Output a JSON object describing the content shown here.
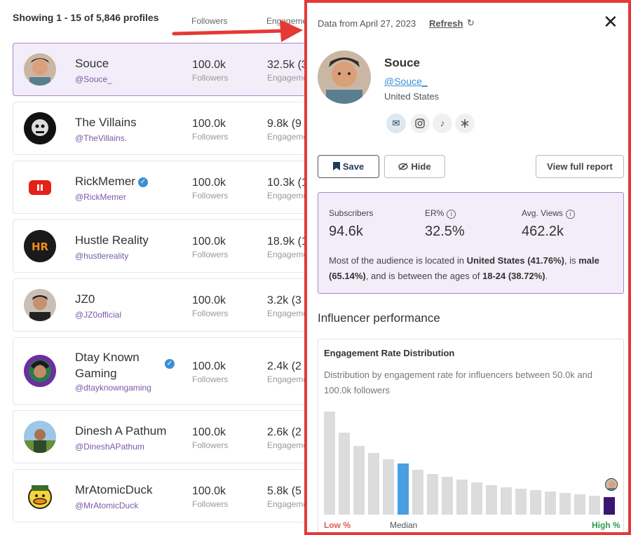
{
  "list": {
    "showing": "Showing 1 - 15 of 5,846 profiles",
    "col_followers": "Followers",
    "col_engagement": "Engagement",
    "profiles": [
      {
        "name": "Souce",
        "handle": "@Souce_",
        "followers": "100.0k",
        "followers_label": "Followers",
        "engagement": "32.5k (3",
        "engagement_label": "Engagement",
        "verified": false
      },
      {
        "name": "The Villains",
        "handle": "@TheVillains.",
        "followers": "100.0k",
        "followers_label": "Followers",
        "engagement": "9.8k (9",
        "engagement_label": "Engagement",
        "verified": false
      },
      {
        "name": "RickMemer",
        "handle": "@RickMemer",
        "followers": "100.0k",
        "followers_label": "Followers",
        "engagement": "10.3k (1",
        "engagement_label": "Engagement",
        "verified": true
      },
      {
        "name": "Hustle Reality",
        "handle": "@hustlereality",
        "followers": "100.0k",
        "followers_label": "Followers",
        "engagement": "18.9k (1",
        "engagement_label": "Engagement",
        "verified": false
      },
      {
        "name": "JZ0",
        "handle": "@JZ0official",
        "followers": "100.0k",
        "followers_label": "Followers",
        "engagement": "3.2k (3",
        "engagement_label": "Engagement",
        "verified": false
      },
      {
        "name": "Dtay Known Gaming",
        "handle": "@dtayknowngaming",
        "followers": "100.0k",
        "followers_label": "Followers",
        "engagement": "2.4k (2",
        "engagement_label": "Engagement",
        "verified": true
      },
      {
        "name": "Dinesh A Pathum",
        "handle": "@DineshAPathum",
        "followers": "100.0k",
        "followers_label": "Followers",
        "engagement": "2.6k (2",
        "engagement_label": "Engagement",
        "verified": false
      },
      {
        "name": "MrAtomicDuck",
        "handle": "@MrAtomicDuck",
        "followers": "100.0k",
        "followers_label": "Followers",
        "engagement": "5.8k (5",
        "engagement_label": "Engagement",
        "verified": false
      }
    ]
  },
  "panel": {
    "data_from": "Data from April 27, 2023",
    "refresh": "Refresh",
    "refresh_icon": "↻",
    "close": "✕",
    "profile": {
      "name": "Souce",
      "handle": "@Souce_",
      "location": "United States"
    },
    "social_icons": [
      "mail-icon",
      "instagram-icon",
      "tiktok-icon",
      "linktree-icon"
    ],
    "buttons": {
      "save": "Save",
      "hide": "Hide",
      "view_report": "View full report"
    },
    "stats": {
      "subscribers_label": "Subscribers",
      "subscribers": "94.6k",
      "er_label": "ER%",
      "er": "32.5%",
      "views_label": "Avg. Views",
      "views": "462.2k"
    },
    "audience": {
      "p1": "Most of the audience is located in ",
      "country": "United States (41.76%)",
      "p2": ", is ",
      "gender": "male (65.14%)",
      "p3": ", and is between the ages of ",
      "age": "18-24 (38.72%)",
      "p4": "."
    },
    "performance_title": "Influencer performance",
    "distribution": {
      "title": "Engagement Rate Distribution",
      "subtitle": "Distribution by engagement rate for influencers between 50.0k and 100.0k followers",
      "low": "Low %",
      "median": "Median",
      "high": "High %"
    }
  },
  "colors": {
    "accent_red": "#e53935",
    "selected_bg": "#f2edf8",
    "handle_purple": "#7a5aa8",
    "median_blue": "#4a9fe0",
    "current_purple": "#3b1670",
    "bar_gray": "#dcdcdc"
  },
  "chart_data": {
    "type": "bar",
    "values": [
      147,
      117,
      98,
      88,
      79,
      73,
      64,
      58,
      54,
      50,
      46,
      42,
      39,
      37,
      35,
      33,
      31,
      29,
      27,
      25
    ],
    "median_index": 5,
    "highlight_index": 19,
    "ylim": [
      0,
      150
    ]
  }
}
